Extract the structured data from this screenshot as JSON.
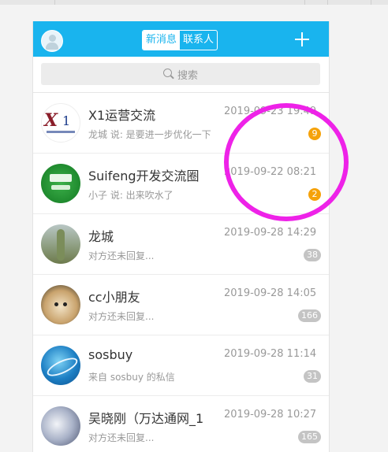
{
  "header": {
    "tabs": [
      {
        "label": "新消息",
        "active": true
      },
      {
        "label": "联系人",
        "active": false
      }
    ]
  },
  "search": {
    "placeholder": "搜索"
  },
  "conversations": [
    {
      "name": "X1运营交流",
      "time": "2019-09-23 19:49",
      "preview": "龙城 说: 是要进一步优化一下",
      "badge": "9",
      "badge_color": "#f5a20a",
      "avatar": "x1-logo-avatar"
    },
    {
      "name": "Suifeng开发交流圈",
      "time": "2019-09-22 08:21",
      "preview": "小子 说: 出来吹水了",
      "badge": "2",
      "badge_color": "#f5a20a",
      "avatar": "green-group-avatar"
    },
    {
      "name": "龙城",
      "time": "2019-09-28 14:29",
      "preview": "对方还未回复...",
      "badge": "38",
      "badge_color": "#c4c4c4",
      "avatar": "cactus-photo-avatar"
    },
    {
      "name": "cc小朋友",
      "time": "2019-09-28 14:05",
      "preview": "对方还未回复...",
      "badge": "166",
      "badge_color": "#c4c4c4",
      "avatar": "puppy-photo-avatar"
    },
    {
      "name": "sosbuy",
      "time": "2019-09-28 11:14",
      "preview": "来自 sosbuy 的私信",
      "badge": "31",
      "badge_color": "#c4c4c4",
      "avatar": "globe-avatar"
    },
    {
      "name": "吴晓刚（万达通网_1",
      "time": "2019-09-28 10:27",
      "preview": "对方还未回复...",
      "badge": "165",
      "badge_color": "#c4c4c4",
      "avatar": "water-drops-avatar"
    }
  ],
  "colors": {
    "header_bg": "#19b4ee",
    "annotation_circle": "#ee22e8"
  }
}
